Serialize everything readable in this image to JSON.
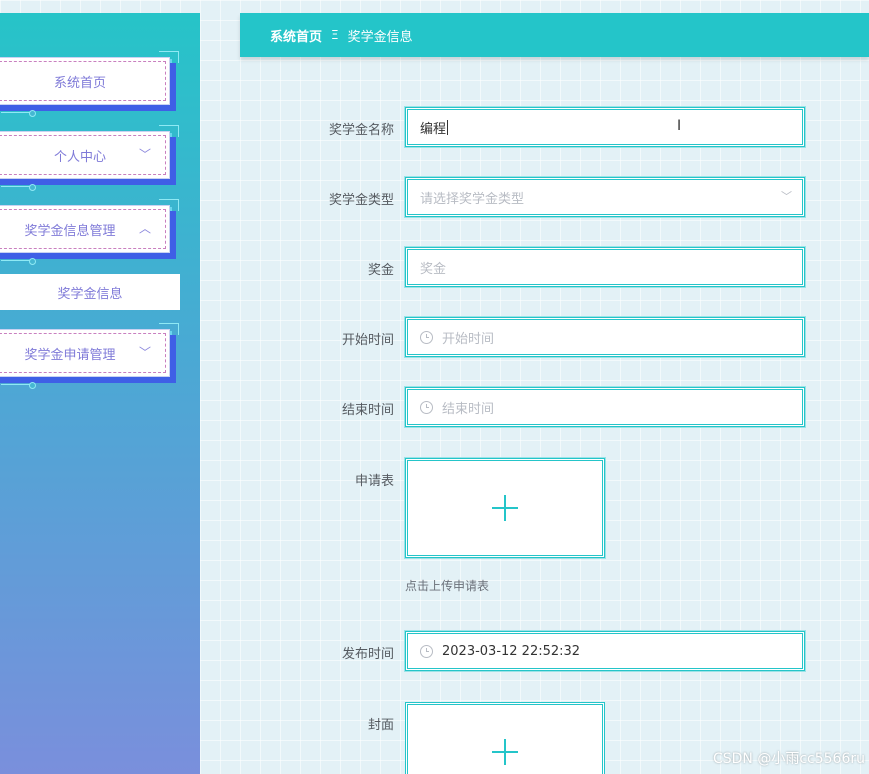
{
  "sidebar": {
    "items": [
      {
        "label": "系统首页",
        "arrow": ""
      },
      {
        "label": "个人中心",
        "arrow": "﹀"
      },
      {
        "label": "奖学金信息管理",
        "arrow": "︿"
      },
      {
        "label": "奖学金申请管理",
        "arrow": "﹀"
      }
    ],
    "submenu": {
      "label": "奖学金信息"
    }
  },
  "breadcrumb": {
    "home": "系统首页",
    "separator": "Ξ",
    "current": "奖学金信息"
  },
  "form": {
    "name": {
      "label": "奖学金名称",
      "value": "编程"
    },
    "type": {
      "label": "奖学金类型",
      "placeholder": "请选择奖学金类型",
      "arrow_icon": "chevron-down-icon"
    },
    "amount": {
      "label": "奖金",
      "placeholder": "奖金"
    },
    "start_time": {
      "label": "开始时间",
      "placeholder": "开始时间",
      "icon": "clock-icon"
    },
    "end_time": {
      "label": "结束时间",
      "placeholder": "结束时间",
      "icon": "clock-icon"
    },
    "application_form": {
      "label": "申请表",
      "hint": "点击上传申请表",
      "icon": "plus-icon"
    },
    "publish_time": {
      "label": "发布时间",
      "value": "2023-03-12 22:52:32",
      "icon": "clock-icon"
    },
    "cover": {
      "label": "封面",
      "icon": "plus-icon"
    }
  },
  "watermark": "CSDN @小雨cc5566ru",
  "colors": {
    "accent": "#24c5c9",
    "menu_text": "#7f7ad8",
    "menu_shadow": "#3f5fe6"
  }
}
